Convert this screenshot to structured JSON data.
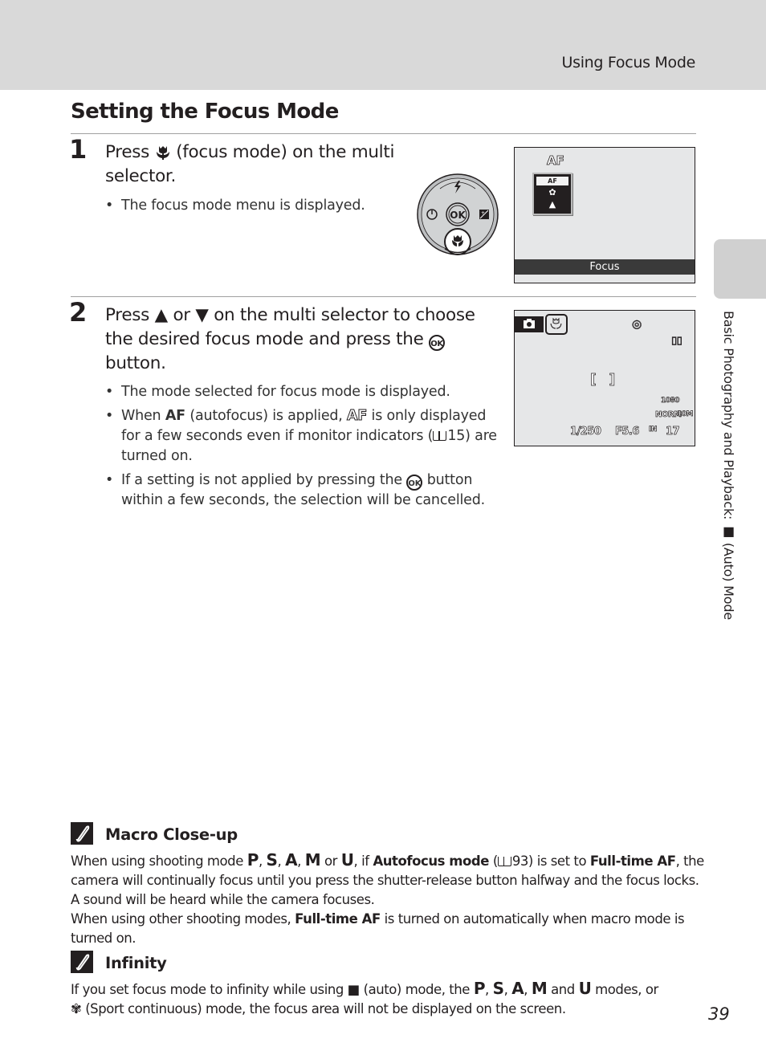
{
  "header": {
    "running_head": "Using Focus Mode"
  },
  "section_title": "Setting the Focus Mode",
  "steps": [
    {
      "number": "1",
      "text_before": "Press",
      "icon": "macro-flower-icon",
      "text_after": "(focus mode) on the multi selector.",
      "bullets": [
        "The focus mode menu is displayed."
      ]
    },
    {
      "number": "2",
      "text_part1": "Press",
      "up_glyph": "▲",
      "or": "or",
      "down_glyph": "▼",
      "text_part2": "on the multi selector to choose the desired focus mode and press the",
      "text_part3": "button.",
      "bullets": {
        "b1": "The mode selected for focus mode is displayed.",
        "b2_when": "When",
        "b2_af": "AF",
        "b2_mid": "(autofocus) is applied,",
        "b2_af2": "AF",
        "b2_rest": "is only displayed for a few seconds even if monitor indicators (",
        "b2_page": "15) are turned on.",
        "b3_start": "If a setting is not applied by pressing the",
        "b3_end": "button within a few seconds, the selection will be cancelled."
      }
    }
  ],
  "multi_selector": {
    "center": "OK",
    "up": "flash-icon",
    "left": "self-timer-icon",
    "right": "exposure-compensation-icon",
    "down": "macro-icon"
  },
  "screen1": {
    "af_indicator": "AF",
    "menu_selected": "AF",
    "menu_options": [
      "macro",
      "infinity"
    ],
    "footer_label": "Focus"
  },
  "screen2": {
    "shutter": "1/250",
    "aperture": "F5.6",
    "exposures_remaining": "17",
    "internal_memory": "IN",
    "image_quality": "NORM",
    "image_size": "10M",
    "movie_mode": "1080"
  },
  "side_tab": {
    "label_before": "Basic Photography and Playback:",
    "label_after": "(Auto) Mode"
  },
  "notes": [
    {
      "title": "Macro Close-up",
      "p1_a": "When using shooting mode",
      "modes": [
        "P",
        "S",
        "A",
        "M",
        "U"
      ],
      "p1_or": "or",
      "p1_b": ", if",
      "p1_bold1": "Autofocus mode",
      "p1_c": "(",
      "p1_page": "93) is set to",
      "p1_bold2": "Full-time AF",
      "p1_d": ", the camera will continually focus until you press the shutter-release button halfway and the focus locks. A sound will be heard while the camera focuses.",
      "p2_a": "When using other shooting modes,",
      "p2_bold": "Full-time AF",
      "p2_b": "is turned on automatically when macro mode is turned on."
    },
    {
      "title": "Infinity",
      "p_a": "If you set focus mode to infinity while using",
      "p_b": "(auto) mode, the",
      "p_and": "and",
      "p_c": "modes, or",
      "p_d": "(Sport continuous) mode, the focus area will not be displayed on the screen."
    }
  ],
  "page_number": "39"
}
